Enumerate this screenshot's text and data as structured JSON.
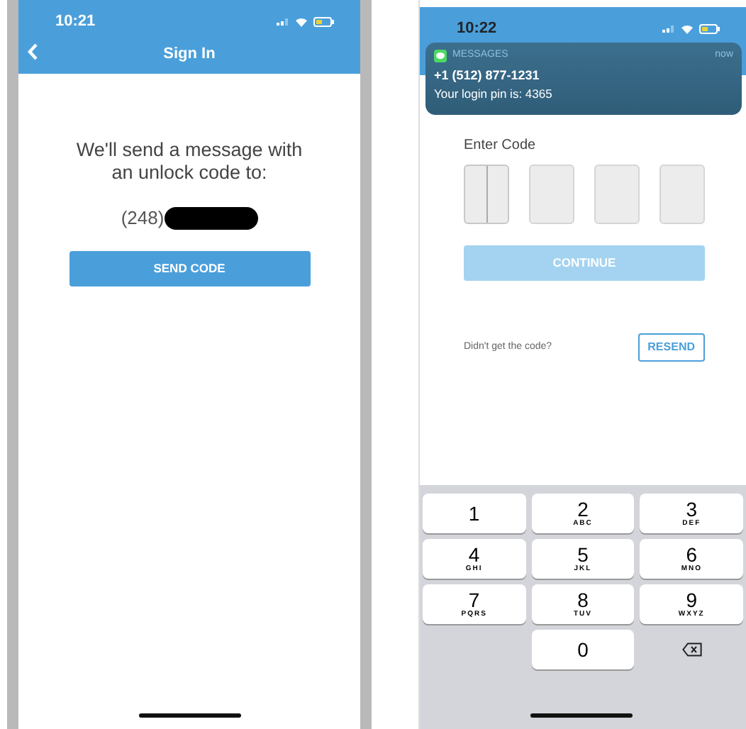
{
  "left_screen": {
    "status_bar": {
      "time": "10:21"
    },
    "nav": {
      "title": "Sign In"
    },
    "message": "We'll send a message with an unlock code to:",
    "phone_number": "(248)",
    "send_button": "SEND CODE"
  },
  "right_screen": {
    "status_bar": {
      "time": "10:22"
    },
    "notification": {
      "app": "MESSAGES",
      "time": "now",
      "sender": "+1 (512) 877-1231",
      "body": "Your login pin is: 4365"
    },
    "code_label": "Enter Code",
    "code_boxes": [
      {
        "focused": true
      },
      {
        "focused": false
      },
      {
        "focused": false
      },
      {
        "focused": false
      }
    ],
    "continue_button": {
      "label": "CONTINUE",
      "disabled": true
    },
    "resend_prompt": "Didn't get the code?",
    "resend_button": "RESEND",
    "keypad": [
      {
        "kind": "digit",
        "digit": "1"
      },
      {
        "kind": "digit",
        "digit": "2",
        "letters": "ABC"
      },
      {
        "kind": "digit",
        "digit": "3",
        "letters": "DEF"
      },
      {
        "kind": "digit",
        "digit": "4",
        "letters": "GHI"
      },
      {
        "kind": "digit",
        "digit": "5",
        "letters": "JKL"
      },
      {
        "kind": "digit",
        "digit": "6",
        "letters": "MNO"
      },
      {
        "kind": "digit",
        "digit": "7",
        "letters": "PQRS"
      },
      {
        "kind": "digit",
        "digit": "8",
        "letters": "TUV"
      },
      {
        "kind": "digit",
        "digit": "9",
        "letters": "WXYZ"
      },
      {
        "kind": "blank"
      },
      {
        "kind": "digit",
        "digit": "0"
      },
      {
        "kind": "delete"
      }
    ]
  }
}
